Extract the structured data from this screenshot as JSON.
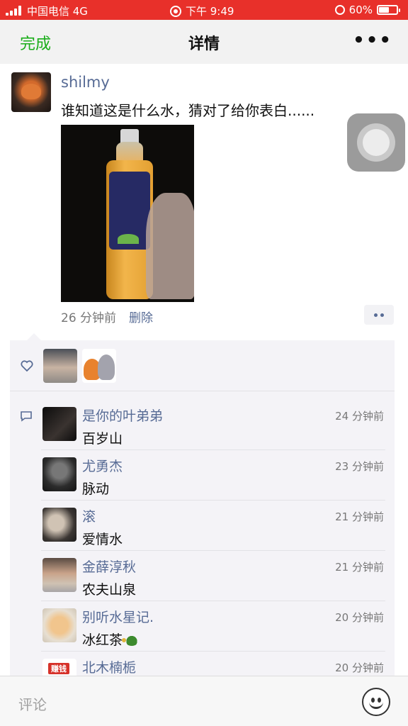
{
  "status_bar": {
    "carrier": "中国电信 4G",
    "time": "下午 9:49",
    "battery": "60%",
    "battery_level": 0.6,
    "background_color": "#e8302a"
  },
  "nav": {
    "done_label": "完成",
    "title": "详情",
    "more_label": "•••",
    "accent_color": "#1aad19"
  },
  "post": {
    "username": "shilmy",
    "text": "谁知道这是什么水，猜对了给你表白......",
    "time": "26 分钟前",
    "delete_label": "删除",
    "link_color": "#576b95"
  },
  "comments": [
    {
      "name": "是你的叶弟弟",
      "time": "24 分钟前",
      "text": "百岁山"
    },
    {
      "name": "尤勇杰",
      "time": "23 分钟前",
      "text": "脉动"
    },
    {
      "name": "滚",
      "time": "21 分钟前",
      "text": "爱情水"
    },
    {
      "name": "金薛淳秋",
      "time": "21 分钟前",
      "text": "农夫山泉"
    },
    {
      "name": "别听水星记.",
      "time": "20 分钟前",
      "text": "冰红茶"
    },
    {
      "name": "北木楠栀",
      "time": "20 分钟前",
      "text": ""
    }
  ],
  "avatar_badge": "赚钱",
  "bottom_bar": {
    "placeholder": "评论"
  }
}
